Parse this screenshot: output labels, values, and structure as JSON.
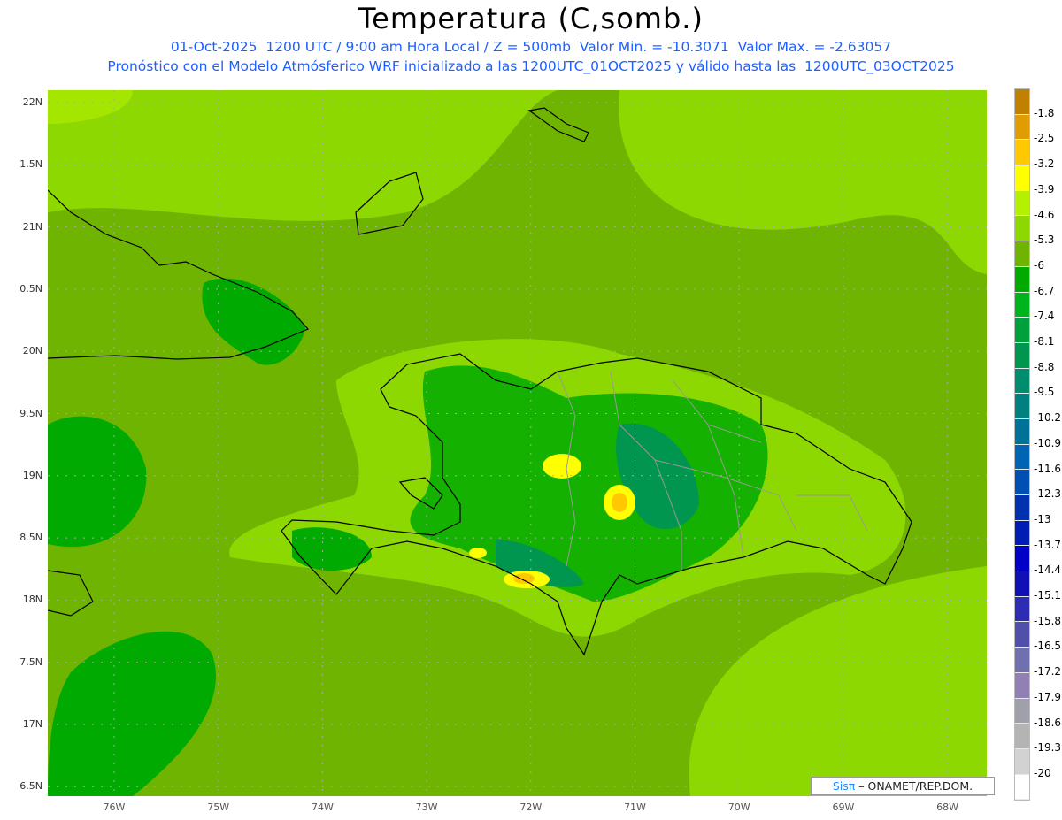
{
  "header": {
    "title": "Temperatura (C,somb.)",
    "line1": "01-Oct-2025  1200 UTC / 9:00 am Hora Local / Z = 500mb  Valor Min. = -10.3071  Valor Max. = -2.63057",
    "line2": "Pronóstico con el Modelo Atmósferico WRF inicializado a las 1200UTC_01OCT2025 y válido hasta las  1200UTC_03OCT2025"
  },
  "axes": {
    "lat_labels": [
      "22N",
      "1.5N",
      "21N",
      "0.5N",
      "20N",
      "9.5N",
      "19N",
      "8.5N",
      "18N",
      "7.5N",
      "17N",
      "6.5N"
    ],
    "lon_labels": [
      "76W",
      "75W",
      "74W",
      "73W",
      "72W",
      "71W",
      "70W",
      "69W",
      "68W"
    ]
  },
  "colorbar": {
    "labels": [
      "-1.8",
      "-2.5",
      "-3.2",
      "-3.9",
      "-4.6",
      "-5.3",
      "-6",
      "-6.7",
      "-7.4",
      "-8.1",
      "-8.8",
      "-9.5",
      "-10.2",
      "-10.9",
      "-11.6",
      "-12.3",
      "-13",
      "-13.7",
      "-14.4",
      "-15.1",
      "-15.8",
      "-16.5",
      "-17.2",
      "-17.9",
      "-18.6",
      "-19.3",
      "-20"
    ],
    "colors": [
      "#c08000",
      "#e09c00",
      "#ffc800",
      "#ffff00",
      "#b4f000",
      "#8cd800",
      "#6eb400",
      "#00aa00",
      "#00b41e",
      "#00a03c",
      "#009650",
      "#008c6e",
      "#008080",
      "#00729a",
      "#0064b4",
      "#0050b4",
      "#0032b0",
      "#001eb4",
      "#0000c8",
      "#1010b4",
      "#2d2db4",
      "#5050aa",
      "#7070b0",
      "#9080b4",
      "#a0a0aa",
      "#b4b4b4",
      "#d2d2d2",
      "#ffffff"
    ]
  },
  "credit": {
    "brand": "Sisπ",
    "text": " – ONAMET/REP.DOM."
  }
}
